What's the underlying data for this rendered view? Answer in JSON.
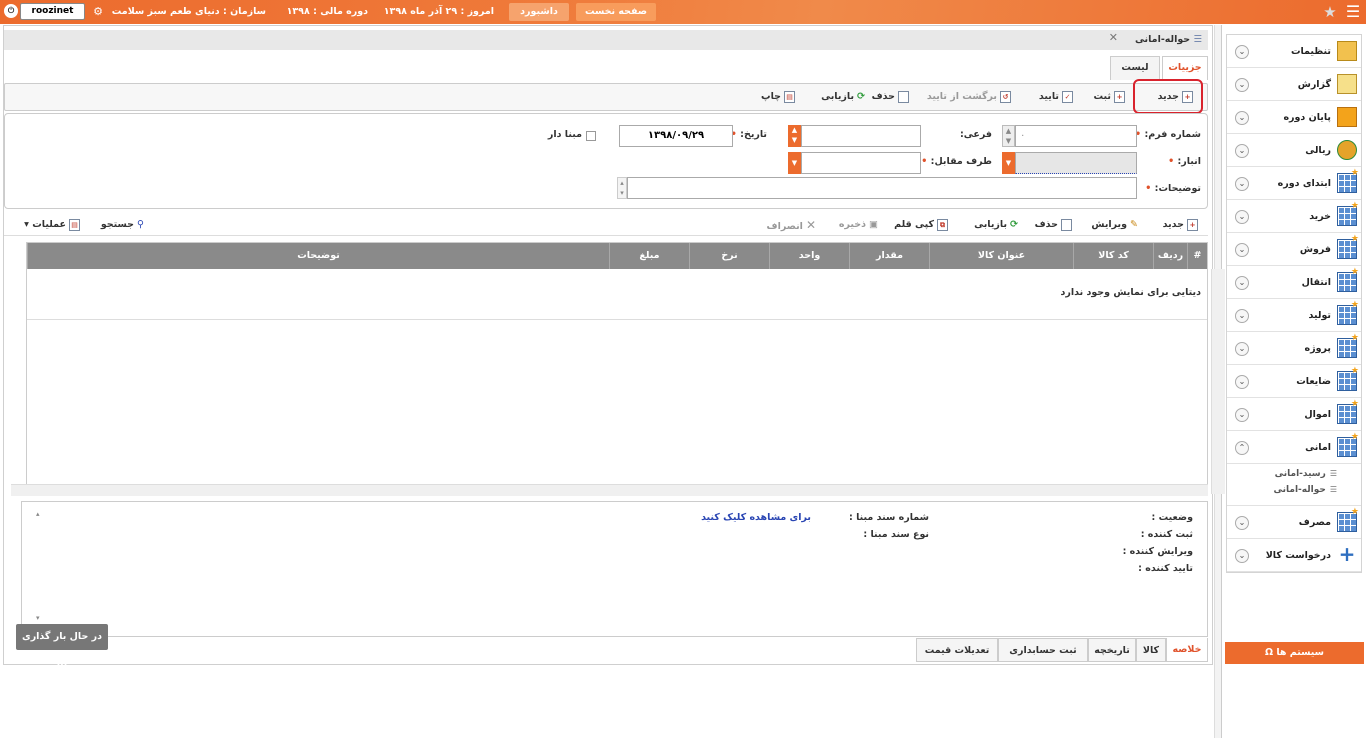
{
  "topbar": {
    "home_label": "صفحه نخست",
    "dashboard_label": "داشبورد",
    "today": "امروز : ۲۹ آذر ماه ۱۳۹۸",
    "fiscal_period": "دوره مالی : ۱۳۹۸",
    "organization": "سازمان : دنیای طعم سبز سلامت",
    "username": "roozinet"
  },
  "sidebar": {
    "items": [
      {
        "label": "تنظیمات"
      },
      {
        "label": "گزارش"
      },
      {
        "label": "پایان دوره"
      },
      {
        "label": "ریالی"
      },
      {
        "label": "ابتدای دوره"
      },
      {
        "label": "خرید"
      },
      {
        "label": "فروش"
      },
      {
        "label": "انتقال"
      },
      {
        "label": "تولید"
      },
      {
        "label": "پروژه"
      },
      {
        "label": "ضایعات"
      },
      {
        "label": "اموال"
      },
      {
        "label": "امانی"
      },
      {
        "label": "مصرف"
      },
      {
        "label": "درخواست کالا"
      }
    ],
    "sub_items": [
      "رسید-امانی",
      "حواله-امانی"
    ],
    "systems_label": "سیستم ها"
  },
  "window": {
    "title": "حواله-امانی",
    "tabs": [
      "جزییات",
      "لیست"
    ]
  },
  "toolbar": {
    "new": "جدید",
    "save": "ثبت",
    "approve": "تایید",
    "revert_approval": "برگشت از تایید",
    "delete": "حذف",
    "refresh": "بازیابی",
    "print": "چاپ"
  },
  "form": {
    "form_number_label": "شماره فرم:",
    "subsidiary_label": "فرعی:",
    "date_label": "تاریخ:",
    "date_value": "۱۳۹۸/۰۹/۲۹",
    "has_source_label": "مبنا دار",
    "warehouse_label": "انبار:",
    "counterparty_label": "طرف مقابل:",
    "description_label": "توضیحات:",
    "form_number_value": "۰"
  },
  "items_toolbar": {
    "new": "جدید",
    "edit": "ویرایش",
    "delete": "حذف",
    "refresh": "بازیابی",
    "copy_item": "کپی قلم",
    "save": "ذخیره",
    "cancel": "انصراف",
    "search": "جستجو",
    "operations": "عملیات"
  },
  "grid": {
    "columns": [
      "#",
      "ردیف",
      "کد کالا",
      "عنوان کالا",
      "مقدار",
      "واحد",
      "نرخ",
      "مبلغ",
      "توضیحات"
    ],
    "empty_message": "دیتایی برای نمایش وجود ندارد"
  },
  "summary": {
    "status_label": "وضعیت :",
    "source_doc_number_label": "شماره سند مبنا :",
    "source_doc_link": "برای مشاهده کلیک کنید",
    "registrar_label": "ثبت کننده :",
    "source_doc_type_label": "نوع سند مبنا :",
    "editor_label": "ویرایش کننده :",
    "approver_label": "تایید کننده :",
    "loading": "در حال بار گذاری ..."
  },
  "bottom_tabs": [
    "خلاصه",
    "کالا",
    "تاریخچه",
    "ثبت حسابداری",
    "تعدیلات قیمت"
  ]
}
